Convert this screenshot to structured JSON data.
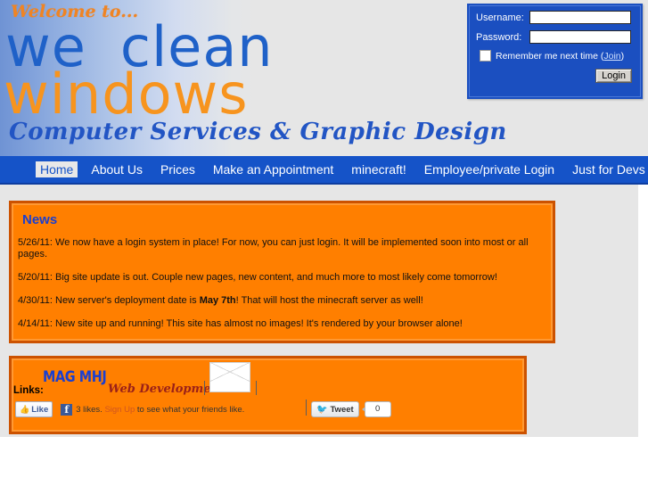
{
  "header": {
    "welcome": "Welcome to...",
    "logo_line1_part1": "we",
    "logo_line1_part2": "clean",
    "logo_line2": "windows",
    "tagline": "Computer Services & Graphic Design",
    "colors": {
      "logo_blue": "#1f61c8",
      "logo_orange": "#f7941e",
      "welcome_orange": "#f08423",
      "tagline_blue": "#2255c4",
      "header_bg": "#e6e6e6"
    }
  },
  "login": {
    "username_label": "Username:",
    "password_label": "Password:",
    "username_value": "",
    "password_value": "",
    "remember_label": "Remember me next time (",
    "join_label": "Join",
    "remember_label_end": ")",
    "login_button": "Login",
    "box_color": "#1b4fc0"
  },
  "nav": {
    "items": [
      {
        "label": "Home",
        "active": true
      },
      {
        "label": "About Us",
        "active": false
      },
      {
        "label": "Prices",
        "active": false
      },
      {
        "label": "Make an Appointment",
        "active": false
      },
      {
        "label": "minecraft!",
        "active": false
      },
      {
        "label": "Employee/private Login",
        "active": false
      },
      {
        "label": "Just for Devs",
        "active": false
      }
    ],
    "bar_color": "#1553c8"
  },
  "news": {
    "title": "News",
    "items": [
      {
        "date": "5/26/11:",
        "text": " We now have a login system in place! For now, you can just login. It will be implemented soon into most or all pages.",
        "bold": ""
      },
      {
        "date": "5/20/11:",
        "text": " Big site update is out. Couple new pages, new content, and much more to most likely come tomorrow!",
        "bold": ""
      },
      {
        "date": "4/30/11:",
        "text": " New server's deployment date is ",
        "bold": "May 7th",
        "text_after": "! That will host the minecraft server as well!"
      },
      {
        "date": "4/14/11:",
        "text": " New site up and running! This site has almost no images! It's rendered by your browser alone!",
        "bold": ""
      }
    ],
    "panel_color": "#ff7f00",
    "border_color": "#cc5200"
  },
  "links": {
    "label": "Links:",
    "brand_name": "MAG MHJ",
    "brand_tagline": "Web Development",
    "envelope_icon": "envelope-icon",
    "facebook": {
      "like_label": "Like",
      "thumb_icon": "thumbs-up-icon",
      "fb_logo": "f",
      "likes_text_before": "3 likes. ",
      "signup_link": "Sign Up",
      "likes_text_after": " to see what your friends like."
    },
    "twitter": {
      "tweet_label": "Tweet",
      "bird_icon": "twitter-bird-icon",
      "count": "0"
    }
  }
}
